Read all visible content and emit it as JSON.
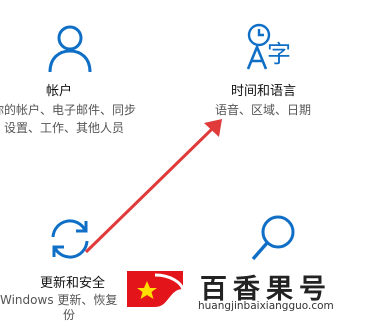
{
  "tiles": {
    "accounts": {
      "icon": "person-icon",
      "title": "帐户",
      "desc_line1": "你的帐户、电子邮件、同步",
      "desc_line2": "设置、工作、其他人员"
    },
    "time_language": {
      "icon": "time-language-icon",
      "title": "时间和语言",
      "desc_line1": "语音、区域、日期"
    },
    "update_security": {
      "icon": "sync-icon",
      "title": "更新和安全",
      "desc_line1": "Windows 更新、恢复",
      "desc_line2": "份"
    },
    "search": {
      "icon": "search-icon"
    }
  },
  "annotation": {
    "arrow_color": "#e03a3a"
  },
  "watermark": {
    "title": "百香果号",
    "url": "huangjinbaixiangguo.com"
  },
  "colors": {
    "accent": "#0f6fc6"
  }
}
